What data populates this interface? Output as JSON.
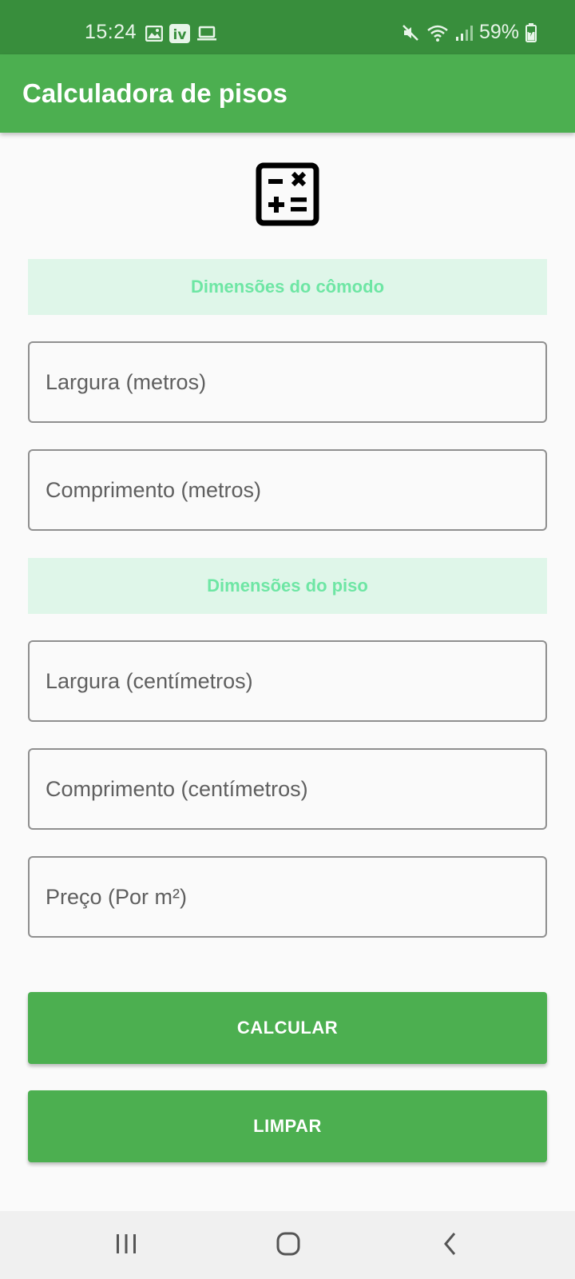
{
  "status_bar": {
    "time": "15:24",
    "battery": "59%",
    "left_icons": [
      "gallery-icon",
      "iv-app-icon",
      "laptop-icon"
    ],
    "right_icons": [
      "mute-icon",
      "wifi-icon",
      "signal-icon",
      "battery-icon"
    ]
  },
  "app_bar": {
    "title": "Calculadora de pisos"
  },
  "header_icon": "calculator-icon",
  "sections": {
    "room": {
      "title": "Dimensões do cômodo"
    },
    "tile": {
      "title": "Dimensões do piso"
    }
  },
  "fields": {
    "room_width": {
      "placeholder": "Largura (metros)",
      "value": ""
    },
    "room_length": {
      "placeholder": "Comprimento (metros)",
      "value": ""
    },
    "tile_width": {
      "placeholder": "Largura (centímetros)",
      "value": ""
    },
    "tile_length": {
      "placeholder": "Comprimento (centímetros)",
      "value": ""
    },
    "price": {
      "placeholder": "Preço (Por m²)",
      "value": ""
    }
  },
  "buttons": {
    "calculate": "CALCULAR",
    "clear": "LIMPAR"
  },
  "nav_bar": {
    "icons": [
      "recent-apps-icon",
      "home-icon",
      "back-icon"
    ]
  },
  "colors": {
    "status_bar": "#388e3c",
    "primary": "#4caf50",
    "section_bg": "#dff6e9",
    "section_text": "#6ee6a4"
  }
}
